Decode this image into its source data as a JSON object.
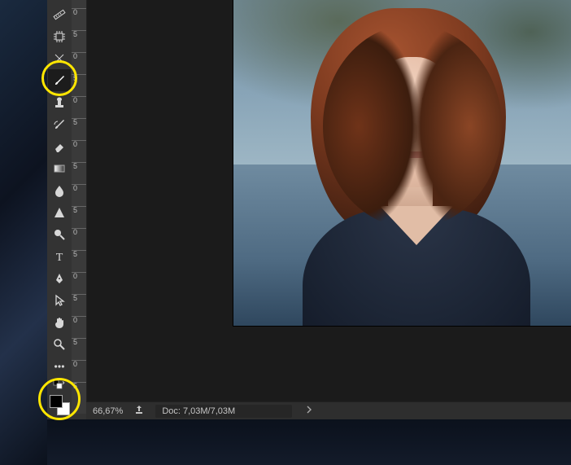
{
  "toolbox": {
    "tools": [
      {
        "name": "ruler-tool",
        "icon": "ruler"
      },
      {
        "name": "chip-tool",
        "icon": "chip"
      },
      {
        "name": "crop-tool",
        "icon": "crop"
      },
      {
        "name": "brush-tool",
        "icon": "brush",
        "selected": true
      },
      {
        "name": "clone-stamp-tool",
        "icon": "stamp"
      },
      {
        "name": "history-brush-tool",
        "icon": "histbrush"
      },
      {
        "name": "eraser-tool",
        "icon": "eraser"
      },
      {
        "name": "gradient-tool",
        "icon": "gradient"
      },
      {
        "name": "blur-tool",
        "icon": "droplet"
      },
      {
        "name": "dodge-tool",
        "icon": "triangle"
      },
      {
        "name": "magnify-tool",
        "icon": "magnify-dark"
      },
      {
        "name": "type-tool",
        "icon": "type"
      },
      {
        "name": "pen-tool",
        "icon": "pen"
      },
      {
        "name": "path-select-tool",
        "icon": "arrow"
      },
      {
        "name": "hand-tool",
        "icon": "hand"
      },
      {
        "name": "zoom-tool",
        "icon": "zoom"
      },
      {
        "name": "more-tools",
        "icon": "dots"
      }
    ],
    "swap_default_icon": "swap-default",
    "foreground_color": "#000000",
    "background_color": "#ffffff"
  },
  "ruler": {
    "major_ticks": [
      "0",
      "5",
      "0",
      "5",
      "0",
      "5",
      "0",
      "5",
      "0",
      "5",
      "0",
      "5",
      "0",
      "5",
      "0",
      "5",
      "0",
      "5"
    ]
  },
  "statusbar": {
    "zoom": "66,67%",
    "doc": "Doc: 7,03M/7,03M"
  },
  "highlights": {
    "brush_tool": true,
    "color_swatches": true
  }
}
